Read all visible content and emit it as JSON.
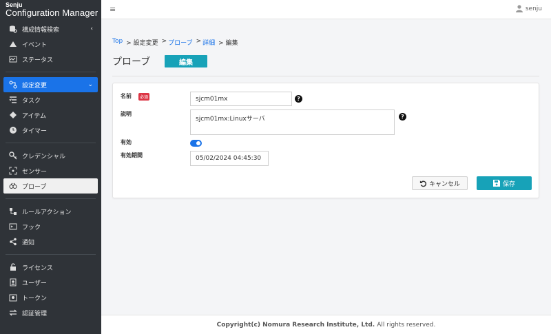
{
  "brand": {
    "line1": "Senju",
    "line2": "Configuration Manager"
  },
  "sidebar": {
    "groups": [
      [
        {
          "label": "構成情報検索",
          "icon": "search-db-icon",
          "chev": "‹"
        },
        {
          "label": "イベント",
          "icon": "event-icon"
        },
        {
          "label": "ステータス",
          "icon": "status-icon"
        }
      ],
      [
        {
          "label": "設定変更",
          "icon": "settings-change-icon",
          "chev": "⌄",
          "active": true
        },
        {
          "label": "タスク",
          "icon": "task-icon"
        },
        {
          "label": "アイテム",
          "icon": "item-icon"
        },
        {
          "label": "タイマー",
          "icon": "timer-icon"
        }
      ],
      [
        {
          "label": "クレデンシャル",
          "icon": "credential-icon"
        },
        {
          "label": "センサー",
          "icon": "sensor-icon"
        },
        {
          "label": "プローブ",
          "icon": "probe-icon",
          "selected": true
        }
      ],
      [
        {
          "label": "ルールアクション",
          "icon": "rule-action-icon"
        },
        {
          "label": "フック",
          "icon": "hook-icon"
        },
        {
          "label": "通知",
          "icon": "notification-icon"
        }
      ],
      [
        {
          "label": "ライセンス",
          "icon": "license-icon"
        },
        {
          "label": "ユーザー",
          "icon": "user-icon"
        },
        {
          "label": "トークン",
          "icon": "token-icon"
        },
        {
          "label": "認証管理",
          "icon": "auth-icon"
        }
      ]
    ]
  },
  "topbar": {
    "menu_icon": "≡",
    "username": "senju"
  },
  "breadcrumb": {
    "top": "Top",
    "sep1": "> 設定変更",
    "sep2": ">",
    "probe": "プローブ",
    "sep3": ">",
    "detail": "詳細",
    "edit": "> 編集"
  },
  "page": {
    "title": "プローブ",
    "badge": "編集"
  },
  "form": {
    "name_label": "名前",
    "required_badge": "必須",
    "name_value": "sjcm01mx",
    "desc_label": "説明",
    "desc_value": "sjcm01mx:Linuxサーバ",
    "enabled_label": "有効",
    "enabled": true,
    "expiry_label": "有効期間",
    "expiry_value": "05/02/2024 04:45:30",
    "help_glyph": "?"
  },
  "buttons": {
    "cancel": "キャンセル",
    "save": "保存"
  },
  "footer": {
    "copyright": "Copyright(c) Nomura Research Institute, Ltd.",
    "rights": "All rights reserved."
  },
  "colors": {
    "accent": "#1a73e8",
    "teal": "#17a2b8",
    "sidebar": "#2f3338",
    "required": "#dc3545"
  }
}
